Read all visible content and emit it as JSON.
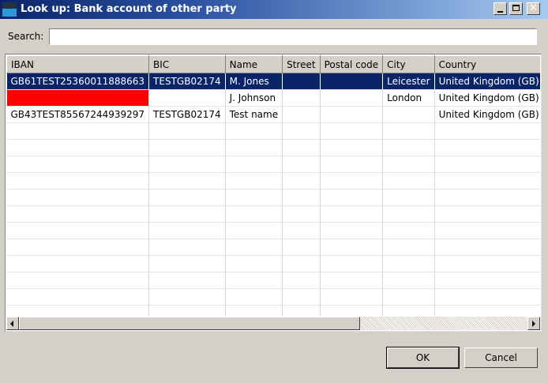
{
  "window": {
    "title": "Look up: Bank account of other party",
    "icon": "app-window-icon",
    "controls": [
      "minimize-icon",
      "maximize-icon",
      "close-icon"
    ],
    "close_glyph": "✕"
  },
  "search": {
    "label": "Search:",
    "value": "",
    "placeholder": ""
  },
  "table": {
    "columns": [
      "IBAN",
      "BIC",
      "Name",
      "Street",
      "Postal code",
      "City",
      "Country"
    ],
    "rows": [
      [
        "GB61TEST25360011888663",
        "TESTGB02174",
        "M. Jones",
        "",
        "",
        "Leicester",
        "United Kingdom (GB)"
      ],
      [
        "",
        "",
        "J. Johnson",
        "",
        "",
        "London",
        "United Kingdom (GB)"
      ],
      [
        "GB43TEST85567244939297",
        "TESTGB02174",
        "Test name",
        "",
        "",
        "",
        "United Kingdom (GB)"
      ]
    ],
    "selected_row": 0,
    "highlight_color": "#0a246a",
    "error_cell_color": "#ff0000"
  },
  "buttons": {
    "ok": "OK",
    "cancel": "Cancel"
  }
}
